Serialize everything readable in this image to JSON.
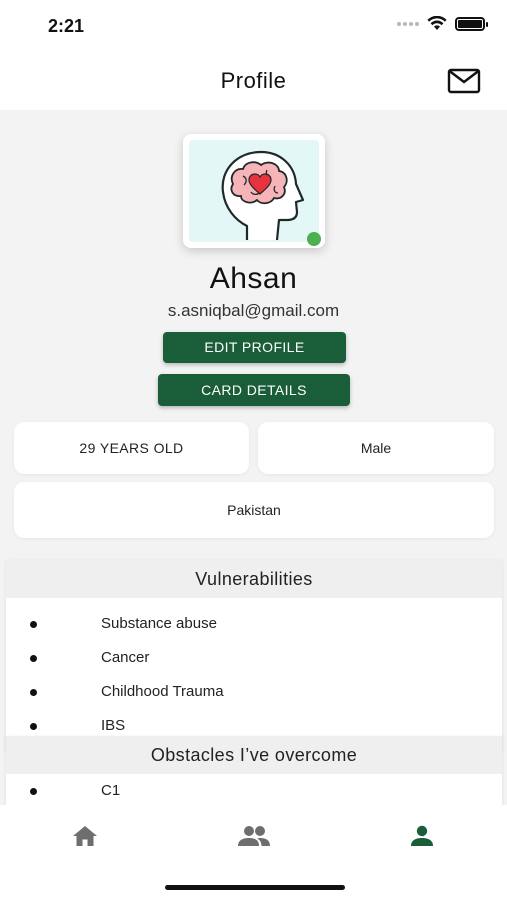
{
  "status_bar": {
    "time": "2:21",
    "icons": [
      "signal-dots-icon",
      "wifi-icon",
      "battery-icon"
    ]
  },
  "header": {
    "title": "Profile",
    "mail_icon": "mail-icon"
  },
  "profile": {
    "name": "Ahsan",
    "email": "s.asniqbal@gmail.com",
    "avatar_icon": "brain-heart-icon",
    "online_color": "#4caf50",
    "edit_button": "EDIT PROFILE",
    "card_button": "CARD DETAILS",
    "age": "29 YEARS OLD",
    "gender": "Male",
    "country": "Pakistan"
  },
  "vulnerabilities": {
    "title": "Vulnerabilities",
    "items": [
      "Substance abuse",
      "Cancer",
      "Childhood Trauma",
      "IBS"
    ]
  },
  "obstacles": {
    "title": "Obstacles I’ve overcome",
    "items": [
      "C1"
    ]
  },
  "tab_bar": {
    "tabs": [
      {
        "icon": "home-icon",
        "active": false
      },
      {
        "icon": "people-icon",
        "active": false
      },
      {
        "icon": "person-icon",
        "active": true
      }
    ],
    "inactive_color": "#6e6e6e",
    "active_color": "#1a5e39"
  },
  "colors": {
    "accent": "#1a5e39",
    "background": "#f3f3f3"
  }
}
